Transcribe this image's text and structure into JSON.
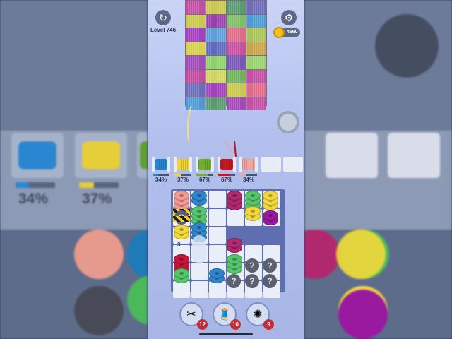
{
  "hud": {
    "level_label": "Level 746",
    "coins": "4660"
  },
  "cloth_colors": [
    "#c24fa3",
    "#c9c84c",
    "#5a9a6e",
    "#6c6db6",
    "#c9c84c",
    "#9a3fb0",
    "#7fbf66",
    "#4e9bd3",
    "#a43fbf",
    "#5ca0d9",
    "#e06a8a",
    "#a9c455",
    "#d7d04c",
    "#5c6bc0",
    "#c64fa0",
    "#c6a54b",
    "#a14ab6",
    "#8ed16a",
    "#7a56b9",
    "#9ad16f",
    "#c14c9f",
    "#d3d45e",
    "#70b35b",
    "#c24fa3",
    "#6c6db6",
    "#a43fbf",
    "#c9c84c",
    "#e06a8a",
    "#4e9bd3",
    "#5a9a6e",
    "#a14ab6",
    "#c24fa3"
  ],
  "spools": [
    {
      "color": "#2b86d1",
      "pct_label": "34%",
      "fill": 0.34
    },
    {
      "color": "#f0d43a",
      "pct_label": "37%",
      "fill": 0.37
    },
    {
      "color": "#6fae2e",
      "pct_label": "67%",
      "fill": 0.67
    },
    {
      "color": "#c31824",
      "pct_label": "67%",
      "fill": 0.67
    },
    {
      "color": "#f1a4a0",
      "pct_label": "34%",
      "fill": 0.34
    }
  ],
  "empty_spool_slots": 2,
  "ghost_count_label": "3",
  "boosters": [
    {
      "name": "scissors",
      "icon": "✂",
      "count": "12"
    },
    {
      "name": "spool-swap",
      "icon": "🧵",
      "count": "10"
    },
    {
      "name": "magnet",
      "icon": "✺",
      "count": "9"
    }
  ],
  "colors": {
    "pink": "#f29a93",
    "blue": "#2f86cc",
    "green": "#55c66d",
    "yellow": "#f3d83b",
    "crimson": "#c4163a",
    "magenta": "#b0296e",
    "purple": "#9a1a9f",
    "mystery": "#5d6070"
  },
  "side_labels": {
    "left_pct_1": "34%",
    "left_pct_2": "37%"
  }
}
